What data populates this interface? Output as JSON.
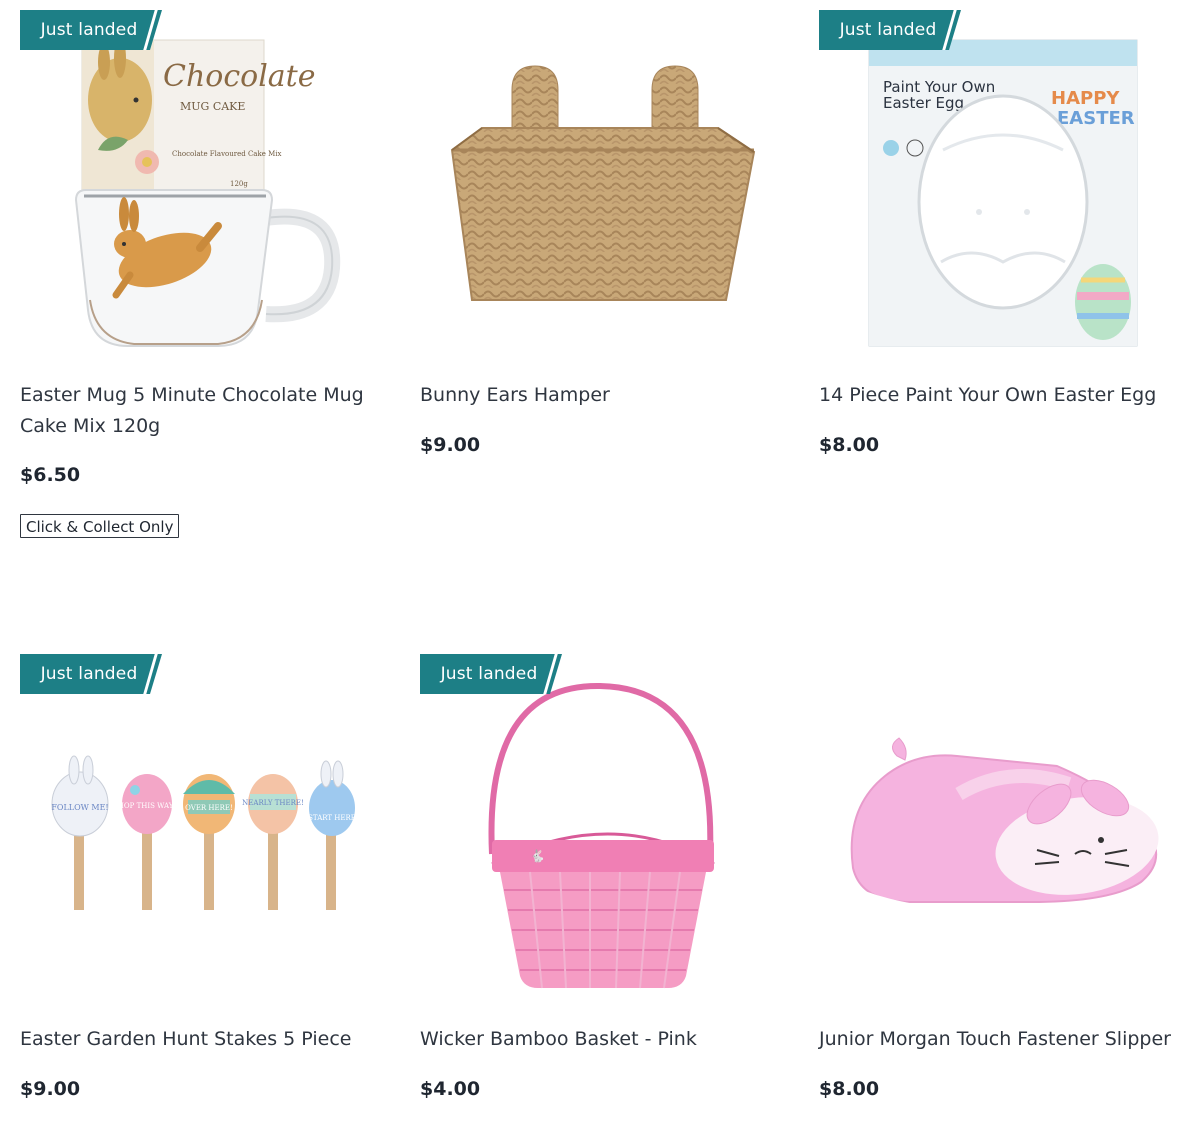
{
  "badge_text": "Just landed",
  "colors": {
    "badge": "#1d7f86",
    "title": "#2f3640",
    "price": "#1f2630"
  },
  "products": [
    {
      "title": "Easter Mug 5 Minute Chocolate Mug Cake Mix 120g",
      "price": "$6.50",
      "badge": "Just landed",
      "tag": "Click & Collect Only",
      "image_text": {
        "brand": "Chocolate",
        "sub": "MUG CAKE",
        "desc": "Chocolate Flavoured Cake Mix",
        "weight": "120g"
      }
    },
    {
      "title": "Bunny Ears Hamper",
      "price": "$9.00",
      "badge": ""
    },
    {
      "title": "14 Piece Paint Your Own Easter Egg",
      "price": "$8.00",
      "badge": "Just landed",
      "image_text": {
        "line1": "Paint Your Own",
        "line2": "Easter Egg",
        "happy": "HAPPY",
        "easter": "EASTER"
      }
    },
    {
      "title": "Easter Garden Hunt Stakes 5 Piece",
      "price": "$9.00",
      "badge": "Just landed",
      "image_text": {
        "s1": "FOLLOW ME!",
        "s2": "HOP THIS WAY!",
        "s3": "OVER HERE!",
        "s4": "NEARLY THERE!",
        "s5": "START HERE"
      }
    },
    {
      "title": "Wicker Bamboo Basket - Pink",
      "price": "$4.00",
      "badge": "Just landed"
    },
    {
      "title": "Junior Morgan Touch Fastener Slipper",
      "price": "$8.00",
      "badge": ""
    }
  ]
}
